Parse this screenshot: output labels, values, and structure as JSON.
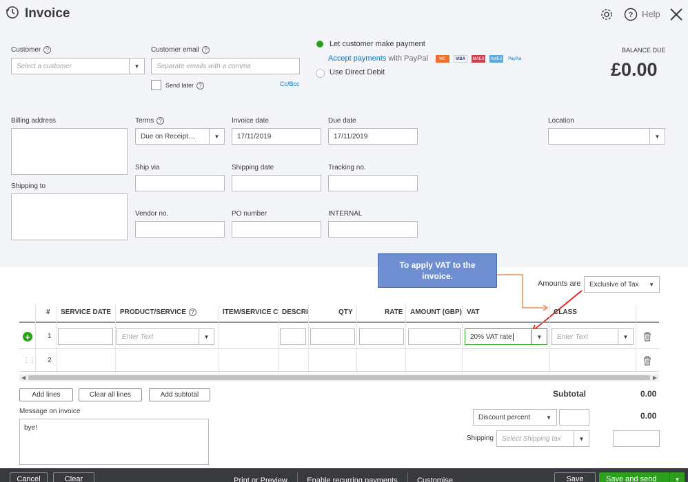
{
  "header": {
    "title": "Invoice",
    "help": "Help"
  },
  "customer": {
    "label": "Customer",
    "placeholder": "Select a customer"
  },
  "email": {
    "label": "Customer email",
    "placeholder": "Separate emails with a comma",
    "send_later": "Send later",
    "cc_bcc": "Cc/Bcc"
  },
  "payment": {
    "let_customer_pay": "Let customer make payment",
    "accept_payments": "Accept payments",
    "with_paypal": " with PayPal",
    "direct_debit": "Use Direct Debit",
    "card_labels": [
      "MC",
      "VISA",
      "MAES",
      "AMEX",
      "PayPal"
    ]
  },
  "balance": {
    "label": "BALANCE DUE",
    "amount": "£0.00"
  },
  "billing": {
    "label": "Billing address",
    "shipping_to": "Shipping to"
  },
  "terms": {
    "label": "Terms",
    "value": "Due on Receipt...."
  },
  "invoice_date": {
    "label": "Invoice date",
    "value": "17/11/2019"
  },
  "due_date": {
    "label": "Due date",
    "value": "17/11/2019"
  },
  "location": {
    "label": "Location"
  },
  "ship_via": {
    "label": "Ship via"
  },
  "shipping_date": {
    "label": "Shipping date"
  },
  "tracking": {
    "label": "Tracking no."
  },
  "vendor": {
    "label": "Vendor no."
  },
  "po": {
    "label": "PO number"
  },
  "internal": {
    "label": "INTERNAL"
  },
  "callout": {
    "text": "To apply VAT to the invoice."
  },
  "amounts": {
    "label": "Amounts are",
    "value": "Exclusive of Tax"
  },
  "table": {
    "headers": [
      "#",
      "SERVICE DATE",
      "PRODUCT/SERVICE",
      "ITEM/SERVICE CC",
      "DESCRI",
      "QTY",
      "RATE",
      "AMOUNT (GBP)",
      "VAT",
      "CLASS"
    ],
    "row1": {
      "num": "1",
      "product_placeholder": "Enter Text",
      "vat": "20% VAT rate",
      "class_placeholder": "Enter Text"
    },
    "row2": {
      "num": "2"
    }
  },
  "actions": {
    "add_lines": "Add lines",
    "clear_all": "Clear all lines",
    "add_subtotal": "Add subtotal"
  },
  "totals": {
    "subtotal_label": "Subtotal",
    "subtotal_value": "0.00",
    "discount_label": "Discount percent",
    "discount_value": "0.00",
    "shipping_label": "Shipping",
    "shipping_placeholder": "Select Shipping tax"
  },
  "message": {
    "label": "Message on invoice",
    "value": "bye!"
  },
  "footer": {
    "cancel": "Cancel",
    "clear": "Clear",
    "print": "Print or Preview",
    "recurring": "Enable recurring payments",
    "customise": "Customise",
    "save": "Save",
    "save_send": "Save and send"
  },
  "colors": {
    "green": "#2ca01c",
    "blue": "#0077c5",
    "callout": "#6f8fd2",
    "footer": "#393a3d"
  }
}
